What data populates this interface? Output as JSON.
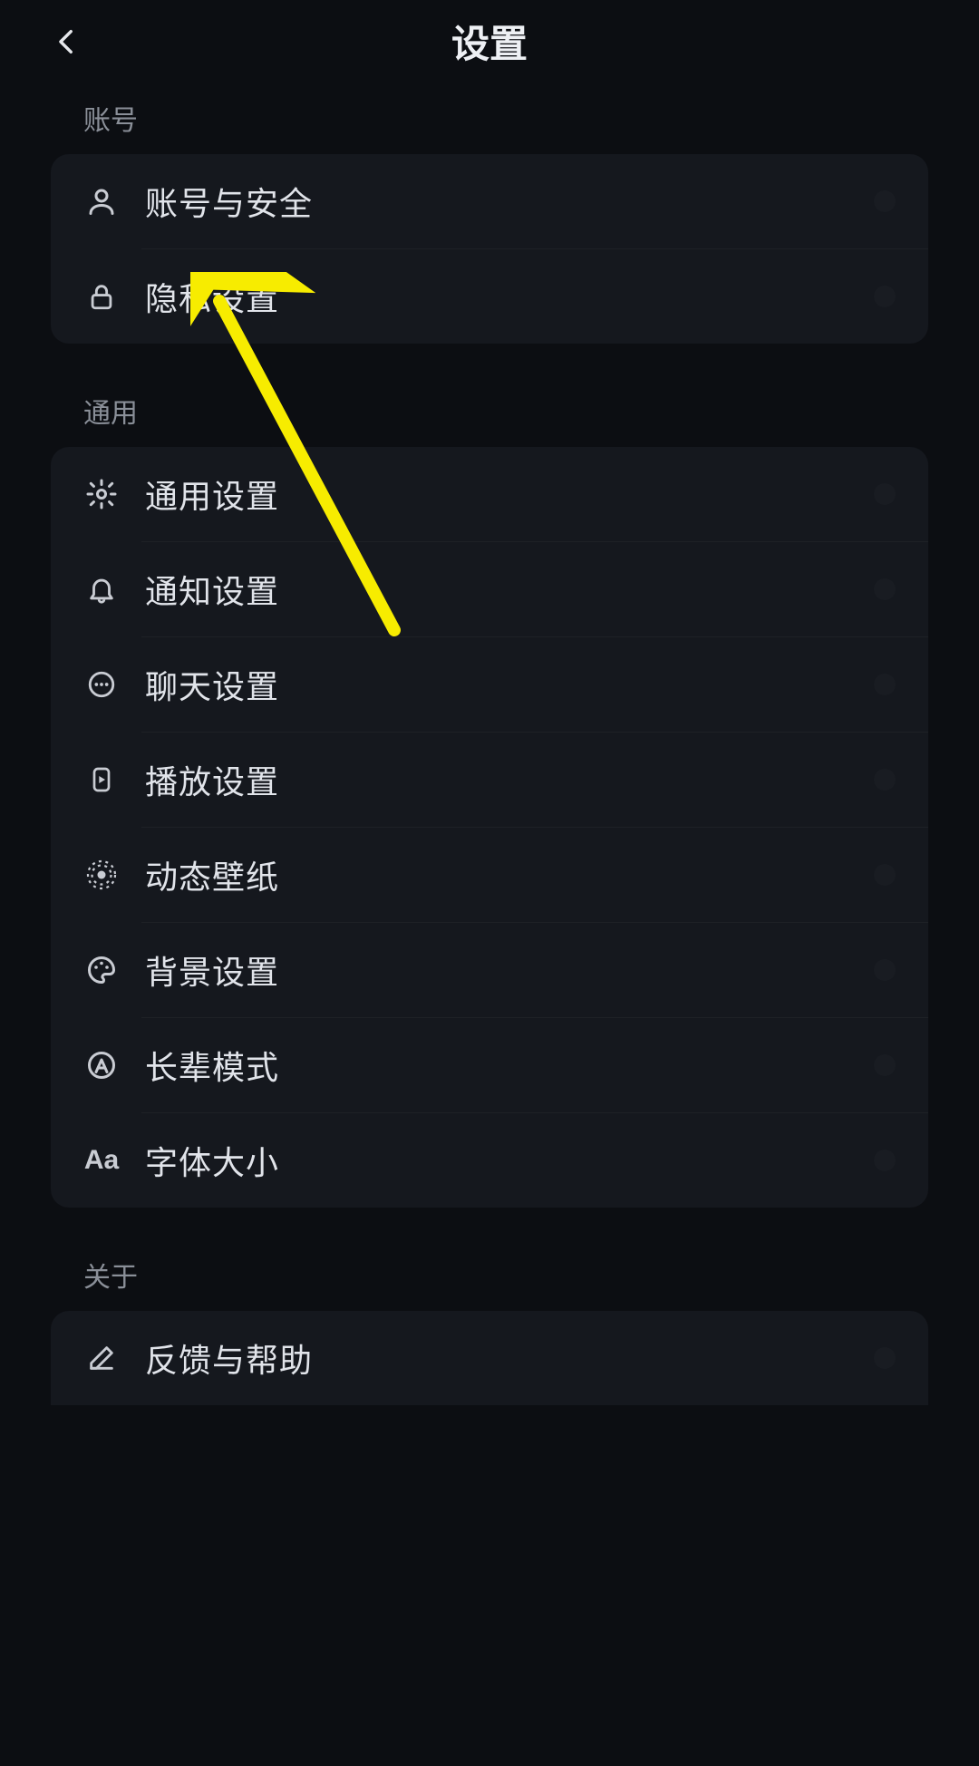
{
  "header": {
    "title": "设置"
  },
  "sections": {
    "account": {
      "header": "账号",
      "items": [
        {
          "label": "账号与安全"
        },
        {
          "label": "隐私设置"
        }
      ]
    },
    "general": {
      "header": "通用",
      "items": [
        {
          "label": "通用设置"
        },
        {
          "label": "通知设置"
        },
        {
          "label": "聊天设置"
        },
        {
          "label": "播放设置"
        },
        {
          "label": "动态壁纸"
        },
        {
          "label": "背景设置"
        },
        {
          "label": "长辈模式"
        },
        {
          "label": "字体大小"
        }
      ]
    },
    "about": {
      "header": "关于",
      "items": [
        {
          "label": "反馈与帮助"
        }
      ]
    }
  },
  "icons": {
    "account_security": "person-icon",
    "privacy": "lock-icon",
    "general_settings": "gear-icon",
    "notifications": "bell-icon",
    "chat_settings": "chat-icon",
    "playback": "play-device-icon",
    "live_wallpaper": "target-icon",
    "background": "palette-icon",
    "elder_mode": "accessibility-icon",
    "font_size": "Aa",
    "feedback": "pencil-icon"
  },
  "annotation": {
    "arrow_color": "#f7ec00"
  }
}
